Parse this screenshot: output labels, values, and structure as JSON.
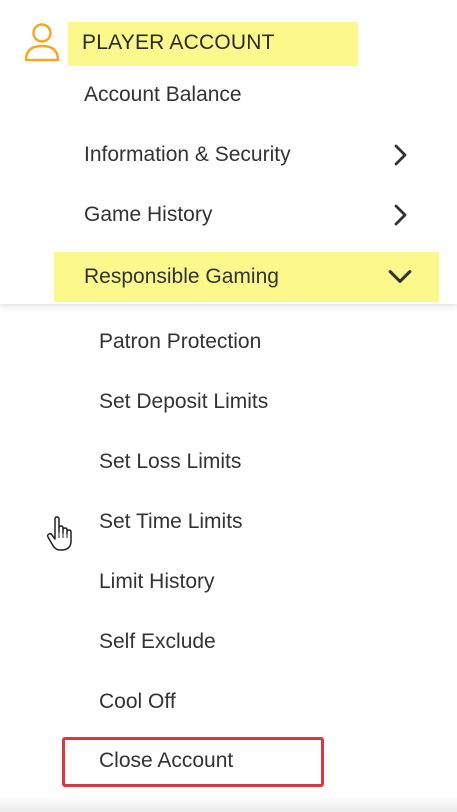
{
  "header": {
    "title": "PLAYER ACCOUNT",
    "icon": "user-icon",
    "highlight_color": "#fbf98b",
    "icon_color": "#f5a623"
  },
  "menu": {
    "items": [
      {
        "label": "Account Balance",
        "chevron": "none"
      },
      {
        "label": "Information & Security",
        "chevron": "right"
      },
      {
        "label": "Game History",
        "chevron": "right"
      },
      {
        "label": "Responsible Gaming",
        "chevron": "down",
        "active": true
      }
    ]
  },
  "submenu": {
    "items": [
      {
        "label": "Patron Protection"
      },
      {
        "label": "Set Deposit Limits"
      },
      {
        "label": "Set Loss Limits"
      },
      {
        "label": "Set Time Limits"
      },
      {
        "label": "Limit History"
      },
      {
        "label": "Self Exclude"
      },
      {
        "label": "Cool Off"
      },
      {
        "label": "Close Account",
        "highlighted": true
      }
    ],
    "highlight_border_color": "#d9393d"
  }
}
